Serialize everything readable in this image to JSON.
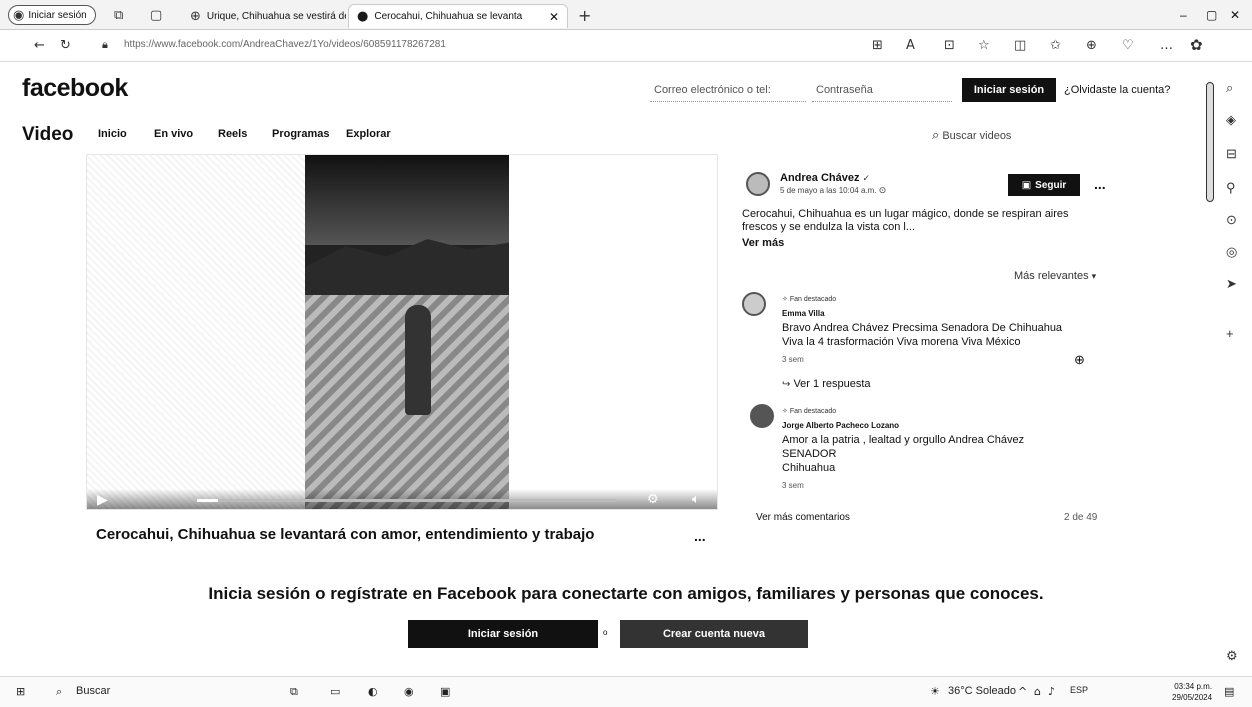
{
  "browser": {
    "profile_label": "Iniciar sesión",
    "tabs": [
      {
        "title": "Urique, Chihuahua se vestirá de"
      },
      {
        "title": "Cerocahui, Chihuahua se levanta"
      }
    ],
    "url": "https://www.facebook.com/AndreaChavez/1Yo/videos/608591178267281",
    "window_controls": {
      "minimize": "–",
      "maximize": "▢",
      "close": "✕"
    }
  },
  "header": {
    "logo": "facebook",
    "email_placeholder": "Correo electrónico o tel:",
    "password_placeholder": "Contraseña",
    "login_label": "Iniciar sesión",
    "forgot_label": "¿Olvidaste la cuenta?"
  },
  "video_nav": {
    "title": "Video",
    "items": [
      "Inicio",
      "En vivo",
      "Reels",
      "Programas",
      "Explorar"
    ],
    "search_placeholder": "Buscar videos"
  },
  "video": {
    "title": "Cerocahui, Chihuahua se levantará con amor, entendimiento y trabajo",
    "more_label": "...",
    "progress": 0.05
  },
  "post": {
    "author": "Andrea Chávez",
    "date": "5 de mayo a las 10:04 a.m.",
    "follow_label": "Seguir",
    "more_label": "...",
    "description": "Cerocahui, Chihuahua es un lugar mágico, donde se respiran aires frescos y se endulza la vista con l...",
    "see_more": "Ver más",
    "sort_label": "Más relevantes"
  },
  "comments": [
    {
      "badge": "Fan destacado",
      "name": "Emma Villa",
      "lines": [
        "Bravo Andrea Chávez Precsima Senadora De Chihuahua",
        "Viva la 4 trasformación Viva morena Viva México"
      ],
      "time": "3 sem"
    },
    {
      "badge": "Fan destacado",
      "name": "Jorge Alberto Pacheco Lozano",
      "lines": [
        "Amor a la patria , lealtad y orgullo Andrea Chávez",
        "SENADOR",
        "Chihuahua"
      ],
      "time": "3 sem"
    }
  ],
  "replies_label": "Ver 1 respuesta",
  "more_comments_label": "Ver más comentarios",
  "comment_count": "2 de 49",
  "cta": {
    "text": "Inicia sesión o regístrate en Facebook para conectarte con amigos, familiares y personas que conoces.",
    "login_label": "Iniciar sesión",
    "or_label": "o",
    "create_label": "Crear cuenta nueva"
  },
  "taskbar": {
    "search_label": "Buscar",
    "weather": "36°C Soleado",
    "lang": "ESP",
    "time": "03:34 p.m.",
    "date": "29/05/2024"
  }
}
